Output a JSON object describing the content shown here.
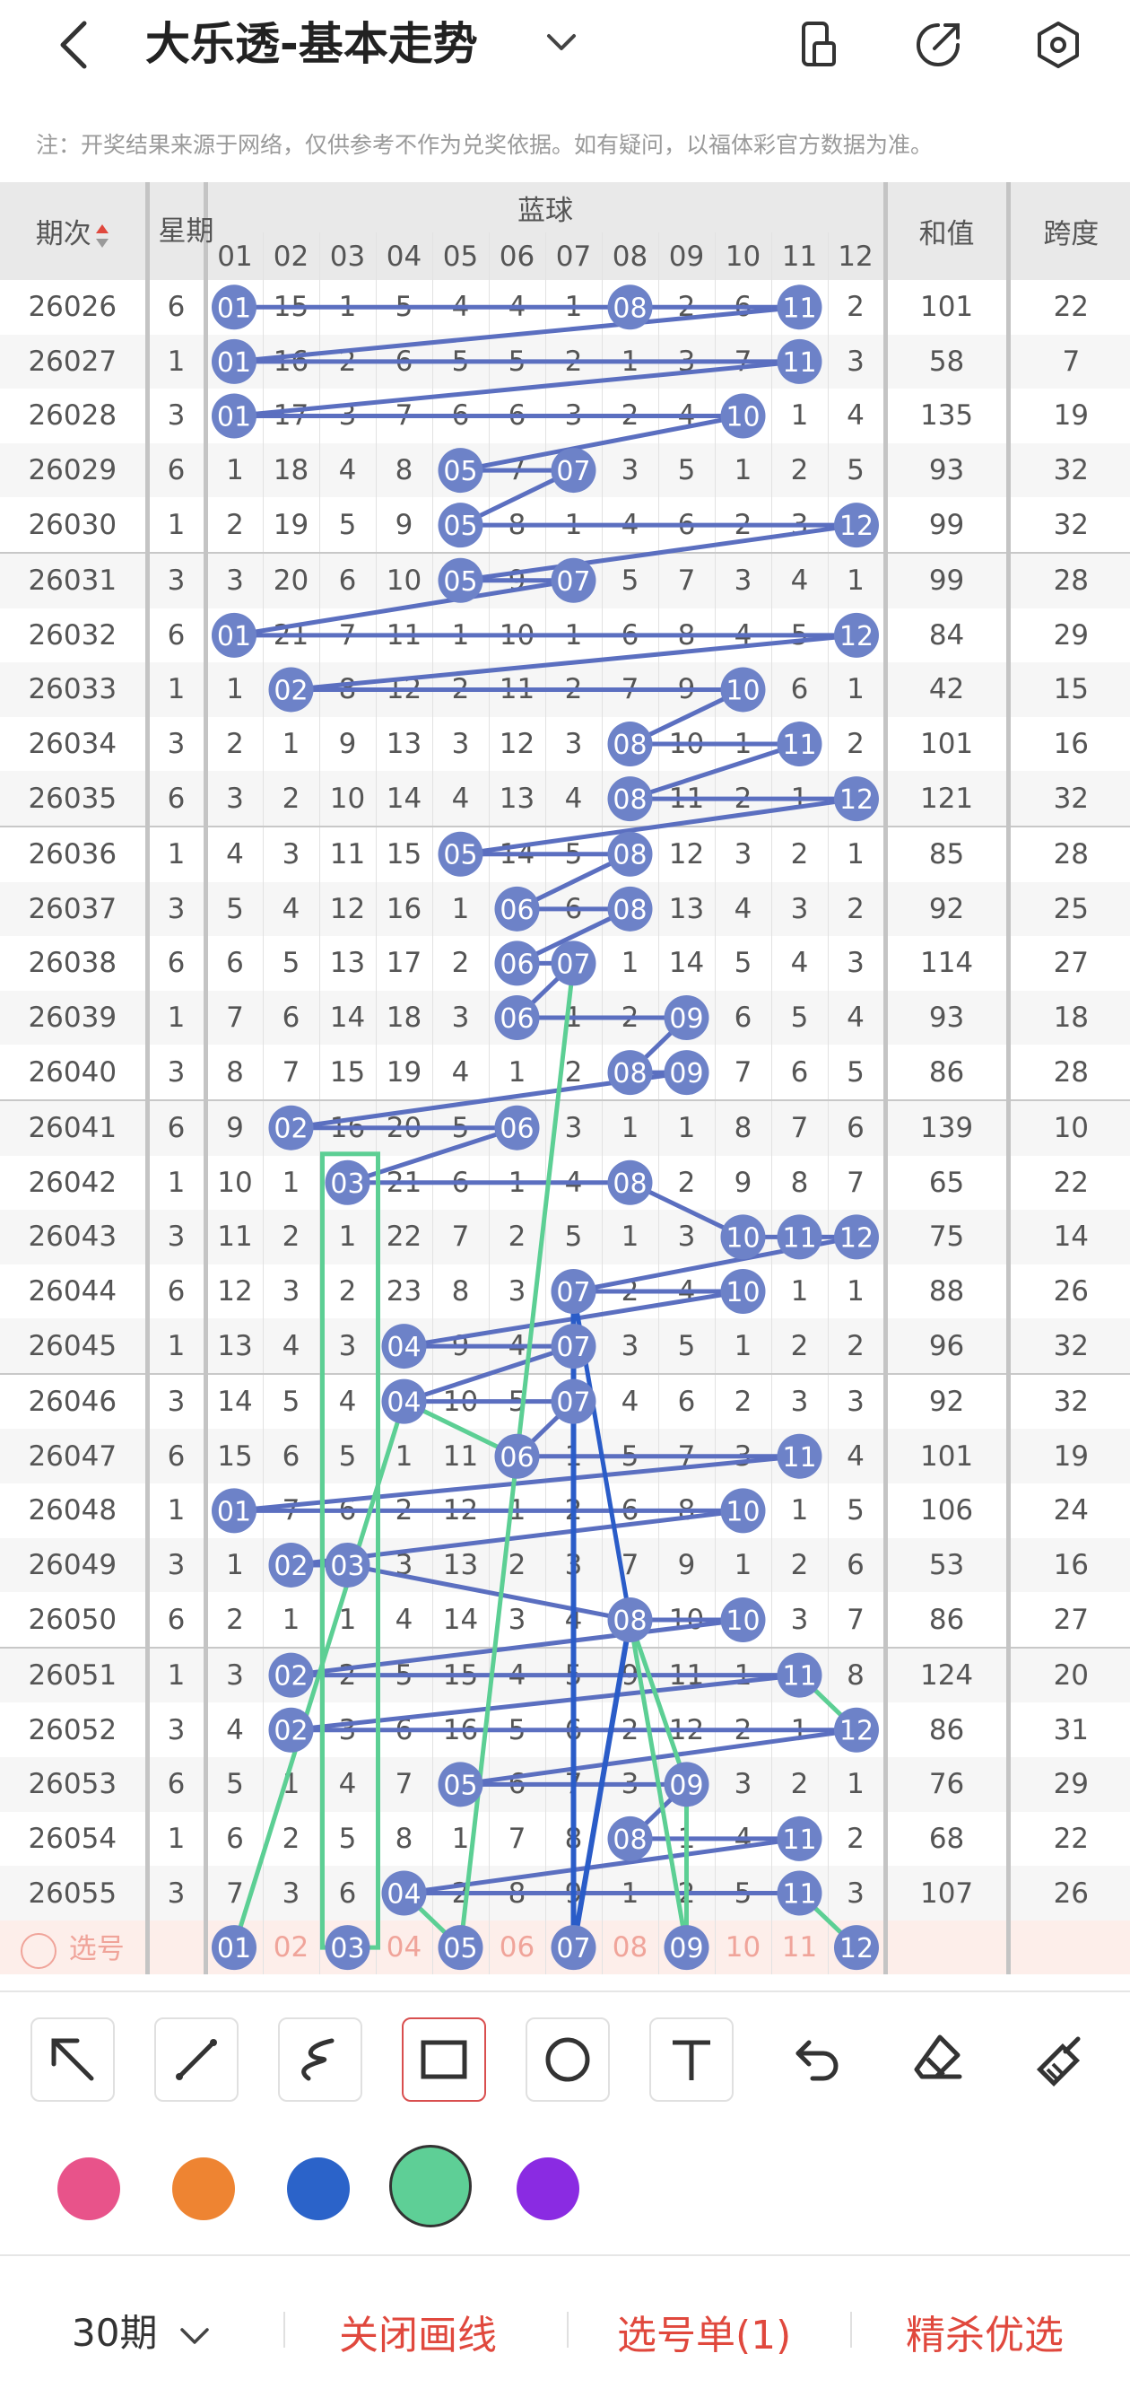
{
  "header": {
    "title": "大乐透-基本走势"
  },
  "notice": "注：开奖结果来源于网络，仅供参考不作为兑奖依据。如有疑问，以福体彩官方数据为准。",
  "table": {
    "col_period": "期次",
    "col_weekday": "星期",
    "group_label": "蓝球",
    "ball_numbers": [
      "01",
      "02",
      "03",
      "04",
      "05",
      "06",
      "07",
      "08",
      "09",
      "10",
      "11",
      "12"
    ],
    "col_sum": "和值",
    "col_span": "跨度",
    "rows": [
      {
        "period": "26026",
        "wd": "6",
        "cells": [
          "01",
          "15",
          "1",
          "5",
          "4",
          "4",
          "1",
          "08",
          "2",
          "6",
          "11",
          "2"
        ],
        "sum": "101",
        "span": "22"
      },
      {
        "period": "26027",
        "wd": "1",
        "cells": [
          "01",
          "16",
          "2",
          "6",
          "5",
          "5",
          "2",
          "1",
          "3",
          "7",
          "11",
          "3"
        ],
        "sum": "58",
        "span": "7"
      },
      {
        "period": "26028",
        "wd": "3",
        "cells": [
          "01",
          "17",
          "3",
          "7",
          "6",
          "6",
          "3",
          "2",
          "4",
          "10",
          "1",
          "4"
        ],
        "sum": "135",
        "span": "19"
      },
      {
        "period": "26029",
        "wd": "6",
        "cells": [
          "1",
          "18",
          "4",
          "8",
          "05",
          "7",
          "07",
          "3",
          "5",
          "1",
          "2",
          "5"
        ],
        "sum": "93",
        "span": "32"
      },
      {
        "period": "26030",
        "wd": "1",
        "cells": [
          "2",
          "19",
          "5",
          "9",
          "05",
          "8",
          "1",
          "4",
          "6",
          "2",
          "3",
          "12"
        ],
        "sum": "99",
        "span": "32"
      },
      {
        "period": "26031",
        "wd": "3",
        "cells": [
          "3",
          "20",
          "6",
          "10",
          "05",
          "9",
          "07",
          "5",
          "7",
          "3",
          "4",
          "1"
        ],
        "sum": "99",
        "span": "28"
      },
      {
        "period": "26032",
        "wd": "6",
        "cells": [
          "01",
          "21",
          "7",
          "11",
          "1",
          "10",
          "1",
          "6",
          "8",
          "4",
          "5",
          "12"
        ],
        "sum": "84",
        "span": "29"
      },
      {
        "period": "26033",
        "wd": "1",
        "cells": [
          "1",
          "02",
          "8",
          "12",
          "2",
          "11",
          "2",
          "7",
          "9",
          "10",
          "6",
          "1"
        ],
        "sum": "42",
        "span": "15"
      },
      {
        "period": "26034",
        "wd": "3",
        "cells": [
          "2",
          "1",
          "9",
          "13",
          "3",
          "12",
          "3",
          "08",
          "10",
          "1",
          "11",
          "2"
        ],
        "sum": "101",
        "span": "16"
      },
      {
        "period": "26035",
        "wd": "6",
        "cells": [
          "3",
          "2",
          "10",
          "14",
          "4",
          "13",
          "4",
          "08",
          "11",
          "2",
          "1",
          "12"
        ],
        "sum": "121",
        "span": "32"
      },
      {
        "period": "26036",
        "wd": "1",
        "cells": [
          "4",
          "3",
          "11",
          "15",
          "05",
          "14",
          "5",
          "08",
          "12",
          "3",
          "2",
          "1"
        ],
        "sum": "85",
        "span": "28"
      },
      {
        "period": "26037",
        "wd": "3",
        "cells": [
          "5",
          "4",
          "12",
          "16",
          "1",
          "06",
          "6",
          "08",
          "13",
          "4",
          "3",
          "2"
        ],
        "sum": "92",
        "span": "25"
      },
      {
        "period": "26038",
        "wd": "6",
        "cells": [
          "6",
          "5",
          "13",
          "17",
          "2",
          "06",
          "07",
          "1",
          "14",
          "5",
          "4",
          "3"
        ],
        "sum": "114",
        "span": "27"
      },
      {
        "period": "26039",
        "wd": "1",
        "cells": [
          "7",
          "6",
          "14",
          "18",
          "3",
          "06",
          "1",
          "2",
          "09",
          "6",
          "5",
          "4"
        ],
        "sum": "93",
        "span": "18"
      },
      {
        "period": "26040",
        "wd": "3",
        "cells": [
          "8",
          "7",
          "15",
          "19",
          "4",
          "1",
          "2",
          "08",
          "09",
          "7",
          "6",
          "5"
        ],
        "sum": "86",
        "span": "28"
      },
      {
        "period": "26041",
        "wd": "6",
        "cells": [
          "9",
          "02",
          "16",
          "20",
          "5",
          "06",
          "3",
          "1",
          "1",
          "8",
          "7",
          "6"
        ],
        "sum": "139",
        "span": "10"
      },
      {
        "period": "26042",
        "wd": "1",
        "cells": [
          "10",
          "1",
          "03",
          "21",
          "6",
          "1",
          "4",
          "08",
          "2",
          "9",
          "8",
          "7"
        ],
        "sum": "65",
        "span": "22"
      },
      {
        "period": "26043",
        "wd": "3",
        "cells": [
          "11",
          "2",
          "1",
          "22",
          "7",
          "2",
          "5",
          "1",
          "3",
          "10",
          "11",
          "12"
        ],
        "sum": "75",
        "span": "14"
      },
      {
        "period": "26044",
        "wd": "6",
        "cells": [
          "12",
          "3",
          "2",
          "23",
          "8",
          "3",
          "07",
          "2",
          "4",
          "10",
          "1",
          "1"
        ],
        "sum": "88",
        "span": "26"
      },
      {
        "period": "26045",
        "wd": "1",
        "cells": [
          "13",
          "4",
          "3",
          "04",
          "9",
          "4",
          "07",
          "3",
          "5",
          "1",
          "2",
          "2"
        ],
        "sum": "96",
        "span": "32"
      },
      {
        "period": "26046",
        "wd": "3",
        "cells": [
          "14",
          "5",
          "4",
          "04",
          "10",
          "5",
          "07",
          "4",
          "6",
          "2",
          "3",
          "3"
        ],
        "sum": "92",
        "span": "32"
      },
      {
        "period": "26047",
        "wd": "6",
        "cells": [
          "15",
          "6",
          "5",
          "1",
          "11",
          "06",
          "1",
          "5",
          "7",
          "3",
          "11",
          "4"
        ],
        "sum": "101",
        "span": "19"
      },
      {
        "period": "26048",
        "wd": "1",
        "cells": [
          "01",
          "7",
          "6",
          "2",
          "12",
          "1",
          "2",
          "6",
          "8",
          "10",
          "1",
          "5"
        ],
        "sum": "106",
        "span": "24"
      },
      {
        "period": "26049",
        "wd": "3",
        "cells": [
          "1",
          "02",
          "03",
          "3",
          "13",
          "2",
          "3",
          "7",
          "9",
          "1",
          "2",
          "6"
        ],
        "sum": "53",
        "span": "16"
      },
      {
        "period": "26050",
        "wd": "6",
        "cells": [
          "2",
          "1",
          "1",
          "4",
          "14",
          "3",
          "4",
          "08",
          "10",
          "10",
          "3",
          "7"
        ],
        "sum": "86",
        "span": "27"
      },
      {
        "period": "26051",
        "wd": "1",
        "cells": [
          "3",
          "02",
          "2",
          "5",
          "15",
          "4",
          "5",
          "9",
          "11",
          "1",
          "11",
          "8"
        ],
        "sum": "124",
        "span": "20"
      },
      {
        "period": "26052",
        "wd": "3",
        "cells": [
          "4",
          "02",
          "3",
          "6",
          "16",
          "5",
          "6",
          "2",
          "12",
          "2",
          "1",
          "12"
        ],
        "sum": "86",
        "span": "31"
      },
      {
        "period": "26053",
        "wd": "6",
        "cells": [
          "5",
          "1",
          "4",
          "7",
          "05",
          "6",
          "7",
          "3",
          "09",
          "3",
          "2",
          "1"
        ],
        "sum": "76",
        "span": "29"
      },
      {
        "period": "26054",
        "wd": "1",
        "cells": [
          "6",
          "2",
          "5",
          "8",
          "1",
          "7",
          "8",
          "08",
          "1",
          "4",
          "11",
          "2"
        ],
        "sum": "68",
        "span": "22"
      },
      {
        "period": "26055",
        "wd": "3",
        "cells": [
          "7",
          "3",
          "6",
          "04",
          "2",
          "8",
          "9",
          "1",
          "2",
          "5",
          "11",
          "3"
        ],
        "sum": "107",
        "span": "26"
      }
    ],
    "pick_label": "选号",
    "pick_selected": [
      "01",
      "03",
      "05",
      "07",
      "09",
      "12"
    ]
  },
  "drawing": {
    "colors": {
      "ball": "#6d82c8",
      "line": "#5b6fc0",
      "green": "#5ccf94",
      "dark": "#2a5cc8"
    }
  },
  "tools": [
    "arrow-tool",
    "line-tool",
    "curve-tool",
    "rectangle-tool",
    "circle-tool",
    "text-tool",
    "undo-tool",
    "eraser-tool",
    "clear-tool"
  ],
  "palette": {
    "colors": [
      "#e8538a",
      "#ee8432",
      "#2b63c9",
      "#5ecf96",
      "#8a2be2"
    ],
    "selected": 3
  },
  "bottom": {
    "period": "30期",
    "close_lines": "关闭画线",
    "pick_list": "选号单(1)",
    "elite": "精杀优选"
  }
}
